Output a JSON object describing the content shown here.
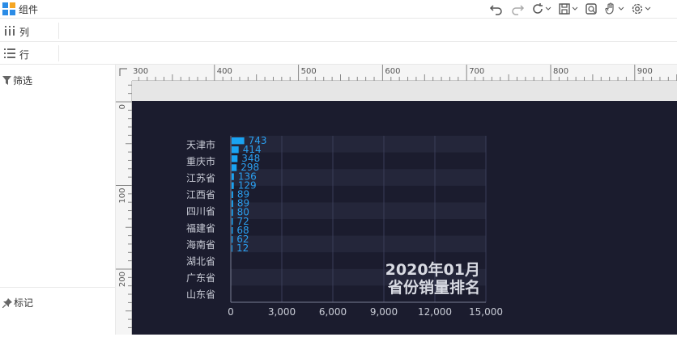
{
  "toolbar": {
    "title": "组件",
    "icons": [
      "undo-icon",
      "redo-icon",
      "refresh-icon",
      "save-icon",
      "preview-icon",
      "hand-icon",
      "settings-icon"
    ]
  },
  "rows": {
    "columns_label": "列",
    "rows_label": "行"
  },
  "left_panel": {
    "filter_label": "筛选",
    "marker_label": "标记"
  },
  "ruler": {
    "h_labels": [
      "300",
      "400",
      "500",
      "600",
      "700",
      "800",
      "900"
    ],
    "v_labels": [
      "0",
      "100",
      "200"
    ]
  },
  "colors": {
    "stage_bg": "#1b1c2e",
    "bar": "#1aa3f2",
    "label_text": "#c9ccd6",
    "value_text": "#2a9ff0",
    "grid": "#3a3d58"
  },
  "chart_data": {
    "type": "bar",
    "orientation": "horizontal",
    "title": "2020年01月\n省份销量排名",
    "title_lines": [
      "2020年01月",
      "省份销量排名"
    ],
    "categories_shown": [
      "天津市",
      "重庆市",
      "江苏省",
      "江西省",
      "四川省",
      "福建省",
      "海南省",
      "湖北省",
      "广东省",
      "山东省"
    ],
    "values": [
      743,
      414,
      348,
      298,
      136,
      129,
      89,
      89,
      80,
      72,
      68,
      62,
      12
    ],
    "value_labels": [
      "743",
      "414",
      "348",
      "298",
      "136",
      "129",
      "89",
      "89",
      "80",
      "72",
      "68",
      "62",
      "12"
    ],
    "x_ticks": [
      "0",
      "3,000",
      "6,000",
      "9,000",
      "12,000",
      "15,000"
    ],
    "xlim": [
      0,
      15000
    ]
  }
}
